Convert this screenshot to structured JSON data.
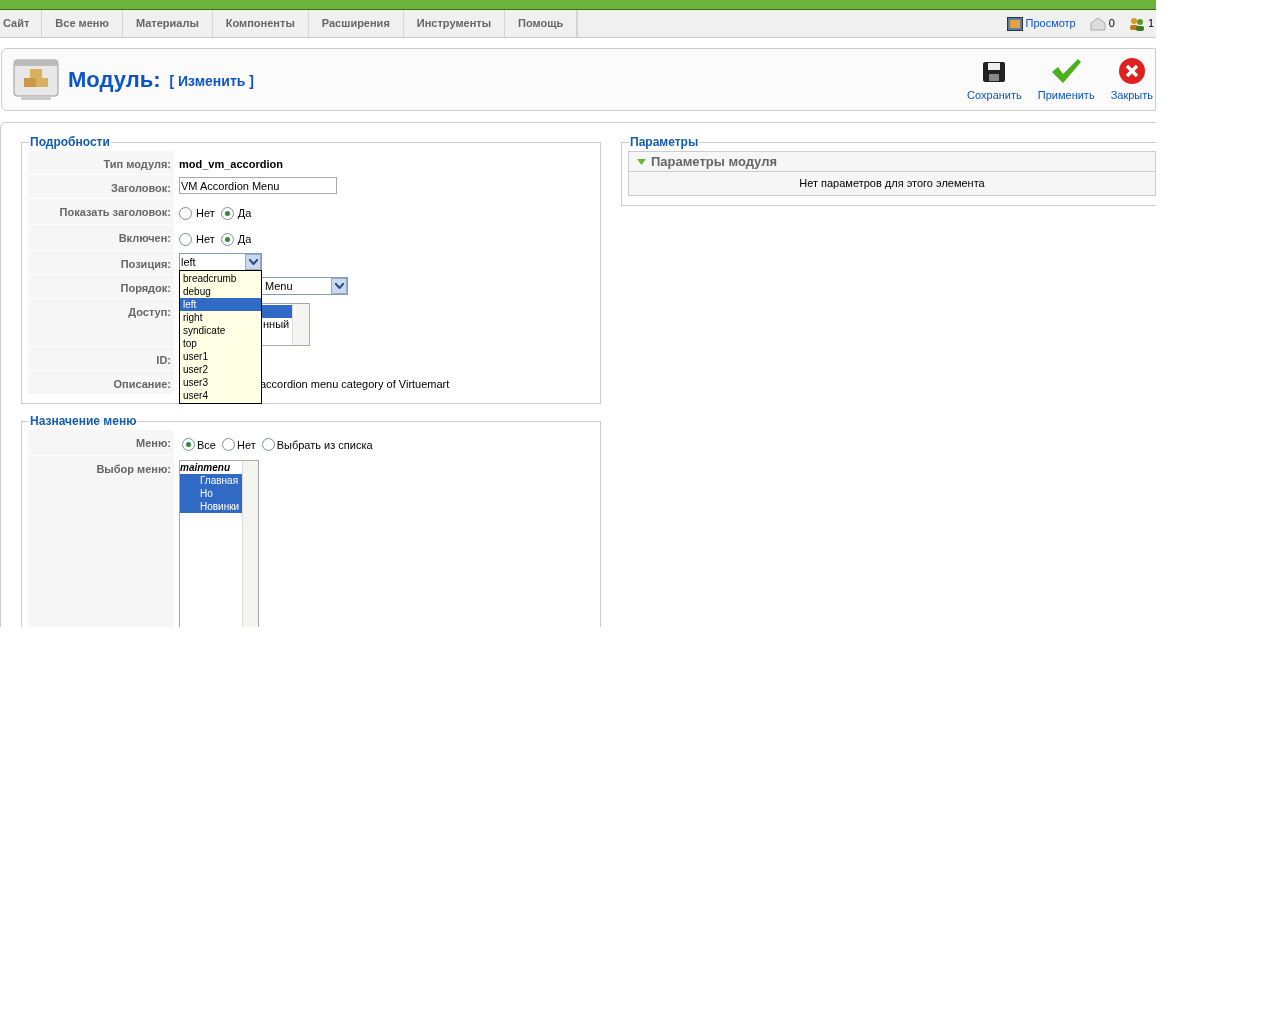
{
  "top_menu": [
    {
      "label": "Сайт"
    },
    {
      "label": "Все меню"
    },
    {
      "label": "Материалы"
    },
    {
      "label": "Компоненты"
    },
    {
      "label": "Расширения"
    },
    {
      "label": "Инструменты"
    },
    {
      "label": "Помощь"
    }
  ],
  "header_links": [
    {
      "kind": "preview",
      "label": "Просмотр"
    },
    {
      "kind": "messages",
      "label": "0"
    },
    {
      "kind": "users",
      "label": "1"
    }
  ],
  "page_title": "Модуль:",
  "page_subtitle": "[ Изменить ]",
  "toolbar": [
    {
      "kind": "save",
      "label": "Сохранить"
    },
    {
      "kind": "apply",
      "label": "Применить"
    },
    {
      "kind": "close",
      "label": "Закрыть"
    }
  ],
  "details": {
    "legend": "Подробности",
    "rows": [
      {
        "kind": "text",
        "label": "Тип модуля:",
        "value": "mod_vm_accordion"
      },
      {
        "kind": "input",
        "label": "Заголовок:",
        "value": "VM Accordion Menu"
      },
      {
        "kind": "radio",
        "label": "Показать заголовок:",
        "options": [
          {
            "label": "Нет",
            "selected": false
          },
          {
            "label": "Да",
            "selected": true
          }
        ]
      },
      {
        "kind": "radio",
        "label": "Включен:",
        "options": [
          {
            "label": "Нет",
            "selected": false
          },
          {
            "label": "Да",
            "selected": true
          }
        ]
      },
      {
        "kind": "select",
        "label": "Позиция:",
        "value": "left",
        "expanded": true,
        "options": [
          {
            "label": "breadcrumb",
            "selected": false
          },
          {
            "label": "debug",
            "selected": false
          },
          {
            "label": "left",
            "selected": true
          },
          {
            "label": "right",
            "selected": false
          },
          {
            "label": "syndicate",
            "selected": false
          },
          {
            "label": "top",
            "selected": false
          },
          {
            "label": "user1",
            "selected": false
          },
          {
            "label": "user2",
            "selected": false
          },
          {
            "label": "user3",
            "selected": false
          },
          {
            "label": "user4",
            "selected": false
          }
        ]
      },
      {
        "kind": "select",
        "label": "Порядок:",
        "value": "Menu",
        "expanded": false
      },
      {
        "kind": "listbox",
        "label": "Доступ:",
        "options": [
          {
            "selected": true
          },
          {
            "label": "нный",
            "selected": false
          }
        ]
      },
      {
        "kind": "empty",
        "label": "ID:"
      },
      {
        "kind": "text",
        "label": "Описание:",
        "value": "accordion menu category of Virtuemart"
      }
    ]
  },
  "menu_assignment": {
    "legend": "Назначение меню",
    "menus_label": "Меню:",
    "menus": [
      {
        "label": "Все",
        "selected": true
      },
      {
        "label": "Нет",
        "selected": false
      },
      {
        "label": "Выбрать из списка",
        "selected": false
      }
    ],
    "selection_label": "Выбор меню:",
    "group": "mainmenu",
    "items": [
      {
        "label": "Главная",
        "selected": true
      },
      {
        "label": "Но",
        "selected": true
      },
      {
        "label": "Новинки",
        "selected": true
      }
    ]
  },
  "parameters": {
    "legend": "Параметры",
    "panel_title": "Параметры модуля",
    "expanded": true,
    "message": "Нет параметров для этого элемента"
  }
}
